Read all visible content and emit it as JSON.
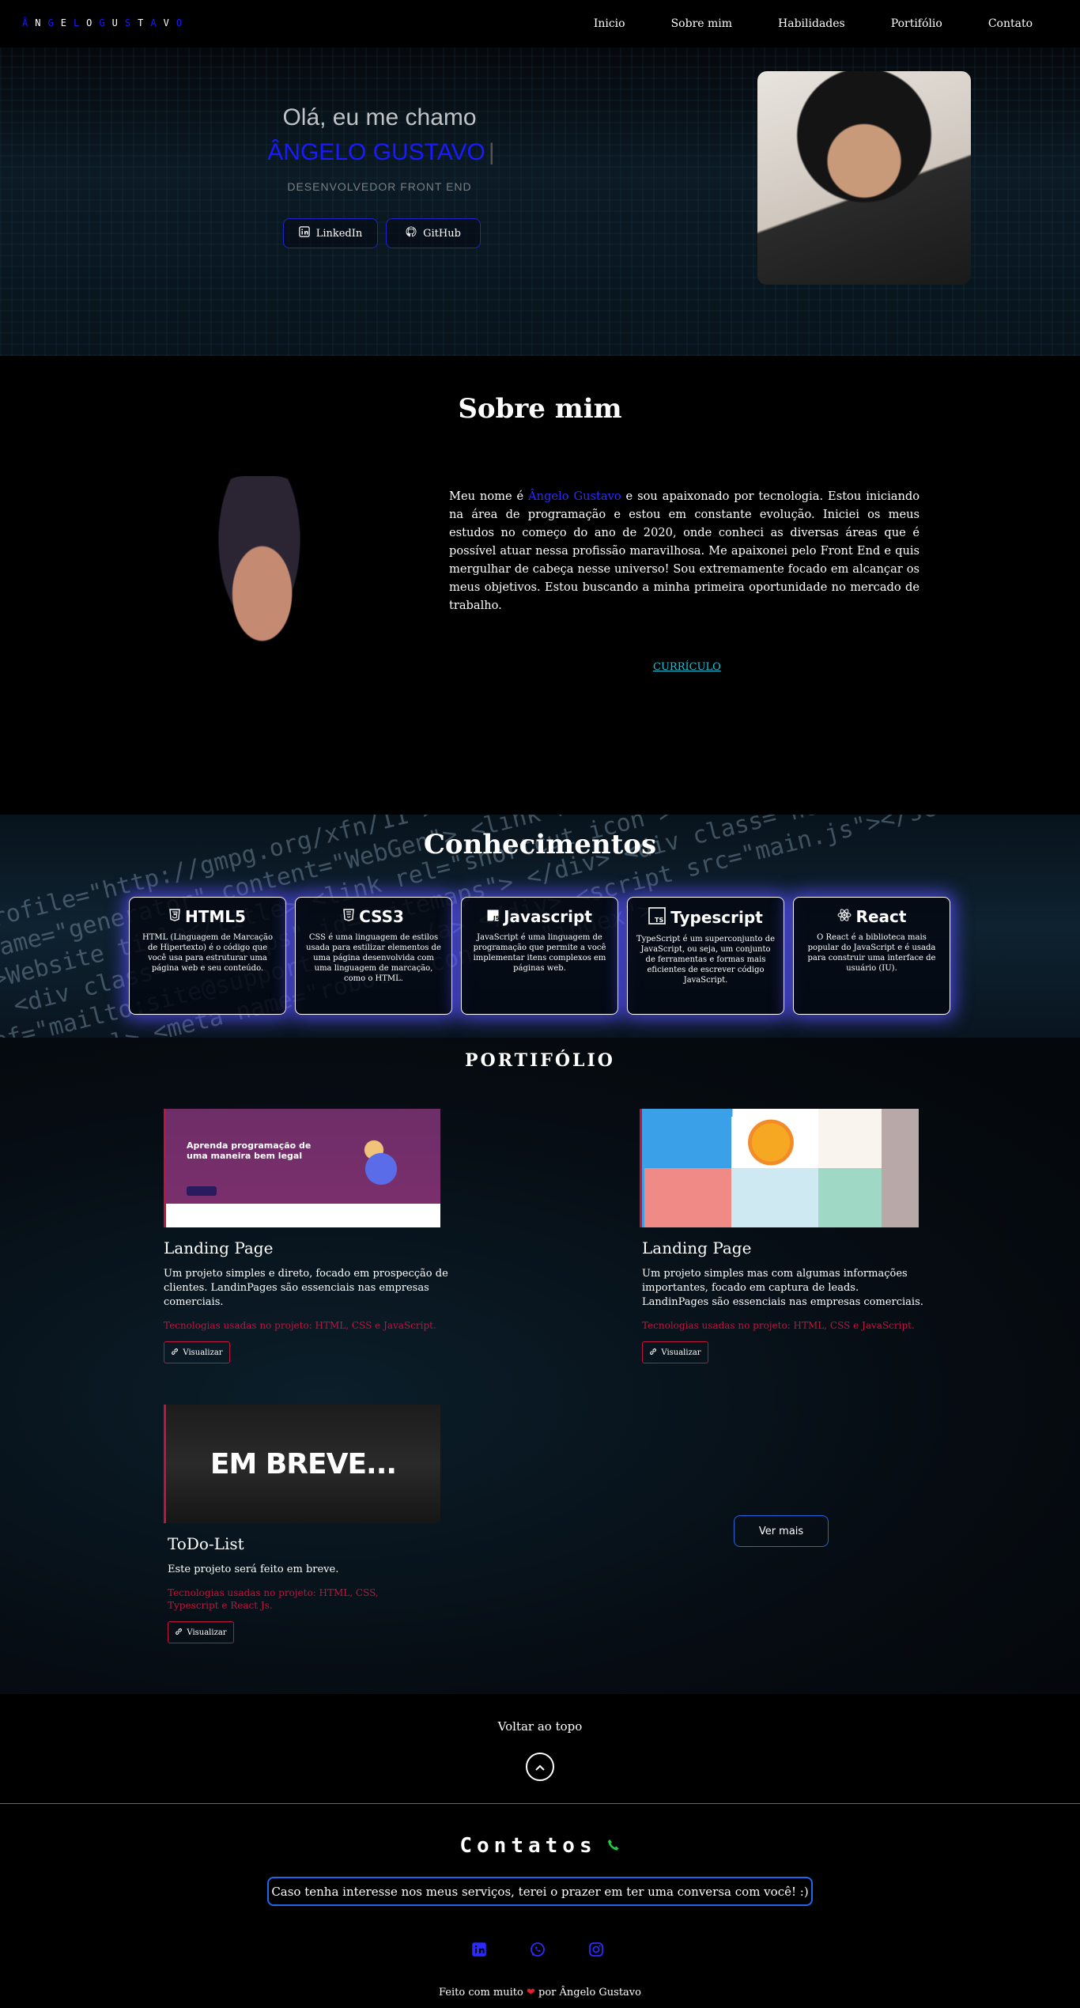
{
  "nav": {
    "logo": "ÂNGELOGUSTAVO",
    "links": [
      "Inicio",
      "Sobre mim",
      "Habilidades",
      "Portifólio",
      "Contato"
    ]
  },
  "hero": {
    "greeting": "Olá, eu me chamo",
    "name": "ÂNGELO GUSTAVO",
    "role": "DESENVOLVEDOR FRONT END",
    "buttons": [
      {
        "label": "LinkedIn",
        "icon": "linkedin-icon"
      },
      {
        "label": "GitHub",
        "icon": "github-icon"
      }
    ]
  },
  "about": {
    "title": "Sobre mim",
    "text_before": "Meu nome é ",
    "name_highlight": "Ângelo Gustavo",
    "text_after": " e sou apaixonado por tecnologia. Estou iniciando na área de programação e estou em constante evolução. Iniciei os meus estudos no começo do ano de 2020, onde conheci as diversas áreas que é possível atuar nessa profissão maravilhosa. Me apaixonei pelo Front End e quis mergulhar de cabeça nesse universo! Sou extremamente focado em alcançar os meus objetivos. Estou buscando a minha primeira oportunidade no mercado de trabalho.",
    "cv_label": "CURRÍCULO"
  },
  "skills": {
    "title": "Conhecimentos",
    "cards": [
      {
        "title": "HTML5",
        "icon": "html5-icon",
        "text": "HTML (Linguagem de Marcação de Hipertexto) é o código que você usa para estruturar uma página web e seu conteúdo."
      },
      {
        "title": "CSS3",
        "icon": "css3-icon",
        "text": "CSS é uma linguagem de estilos usada para estilizar elementos de uma página desenvolvida com uma linguagem de marcação, como o HTML."
      },
      {
        "title": "Javascript",
        "icon": "javascript-icon",
        "text": "JavaScript é uma linguagem de programação que permite a você implementar itens complexos em páginas web."
      },
      {
        "title": "Typescript",
        "icon": "typescript-icon",
        "text": "TypeScript é um superconjunto de JavaScript, ou seja, um conjunto de ferramentas e formas mais eficientes de escrever código JavaScript."
      },
      {
        "title": "React",
        "icon": "react-icon",
        "text": "O React é a biblioteca mais popular do JavaScript e é usada para construir uma interface de usuário (IU)."
      }
    ]
  },
  "portfolio": {
    "title": "PORTIFÓLIO",
    "projects": [
      {
        "image_title": "Aprenda programação de uma maneira bem legal",
        "title": "Landing Page",
        "desc": "Um projeto simples e direto, focado em prospecção de clientes. LandinPages são essenciais nas empresas comerciais.",
        "tech": "Tecnologias usadas no projeto: HTML, CSS e JavaScript.",
        "button": "Visualizar"
      },
      {
        "image_title": "",
        "title": "Landing Page",
        "desc": "Um projeto simples mas com algumas informações importantes, focado em captura de leads. LandinPages são essenciais nas empresas comerciais.",
        "tech": "Tecnologias usadas no projeto: HTML, CSS e JavaScript.",
        "button": "Visualizar"
      },
      {
        "image_title": "EM BREVE...",
        "title": "ToDo-List",
        "desc": "Este projeto será feito em breve.",
        "tech": "Tecnologias usadas no projeto: HTML, CSS, Typescript e React Js.",
        "button": "Visualizar"
      }
    ],
    "more_label": "Ver mais"
  },
  "back_to_top": {
    "label": "Voltar ao topo",
    "icon": "chevron-up-icon"
  },
  "contacts": {
    "title": "Contatos",
    "phone_icon": "phone-icon",
    "message": "Caso tenha interesse nos meus serviços, terei o prazer em ter uma conversa com você! :)",
    "social": [
      "linkedin-icon",
      "whatsapp-icon",
      "instagram-icon"
    ],
    "footer_before": "Feito com muito",
    "footer_after": "por Ângelo Gustavo"
  },
  "colors": {
    "accent_blue": "#1a1aff",
    "accent_red": "#c0143c",
    "cyan": "#19c3d8",
    "green": "#22cc44"
  }
}
